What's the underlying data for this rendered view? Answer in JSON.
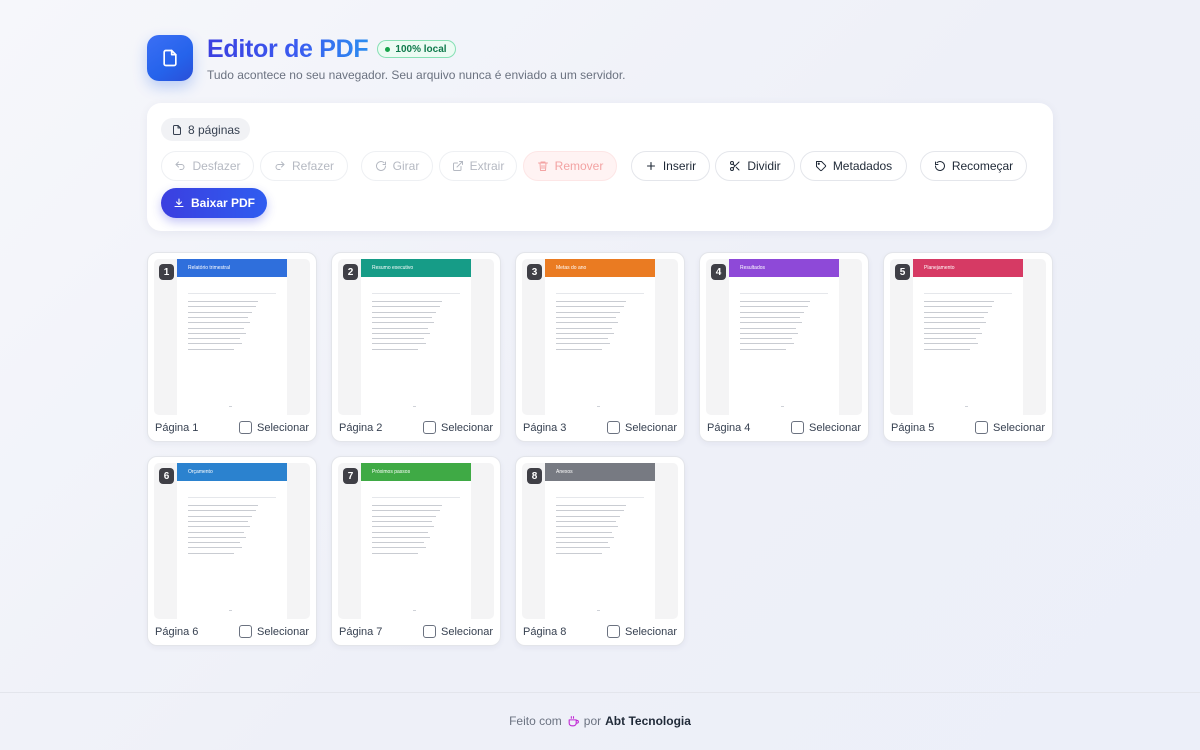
{
  "header": {
    "title": "Editor de PDF",
    "badge": "100% local",
    "subtitle": "Tudo acontece no seu navegador. Seu arquivo nunca é enviado a um servidor."
  },
  "toolbar": {
    "page_count": "8 páginas",
    "undo": "Desfazer",
    "redo": "Refazer",
    "rotate": "Girar",
    "extract": "Extrair",
    "remove": "Remover",
    "insert": "Inserir",
    "split": "Dividir",
    "metadata": "Metadados",
    "restart": "Recomeçar",
    "download": "Baixar PDF"
  },
  "pages": [
    {
      "number": "1",
      "label": "Página 1",
      "select": "Selecionar",
      "heading": "Relatório trimestral",
      "color": "#2f6fdc"
    },
    {
      "number": "2",
      "label": "Página 2",
      "select": "Selecionar",
      "heading": "Resumo executivo",
      "color": "#169c87"
    },
    {
      "number": "3",
      "label": "Página 3",
      "select": "Selecionar",
      "heading": "Metas do ano",
      "color": "#ea7b22"
    },
    {
      "number": "4",
      "label": "Página 4",
      "select": "Selecionar",
      "heading": "Resultados",
      "color": "#8e49d8"
    },
    {
      "number": "5",
      "label": "Página 5",
      "select": "Selecionar",
      "heading": "Planejamento",
      "color": "#d63a64"
    },
    {
      "number": "6",
      "label": "Página 6",
      "select": "Selecionar",
      "heading": "Orçamento",
      "color": "#2b82cf"
    },
    {
      "number": "7",
      "label": "Página 7",
      "select": "Selecionar",
      "heading": "Próximos passos",
      "color": "#3faa45"
    },
    {
      "number": "8",
      "label": "Página 8",
      "select": "Selecionar",
      "heading": "Anexos",
      "color": "#777a82"
    }
  ],
  "footer": {
    "made_with": "Feito com",
    "by": "por",
    "brand": "Abt Tecnologia"
  },
  "colors": {
    "accent": "#3b3fe0",
    "badge_green": "#16a34a",
    "danger": "#f3a3a3"
  },
  "icons": {
    "logo": "document-icon",
    "undo": "undo-icon",
    "redo": "redo-icon",
    "rotate": "rotate-icon",
    "extract": "external-link-icon",
    "remove": "trash-icon",
    "insert": "plus-icon",
    "split": "scissors-icon",
    "metadata": "tag-icon",
    "restart": "reset-icon",
    "download": "download-icon",
    "footer": "coffee-icon"
  }
}
